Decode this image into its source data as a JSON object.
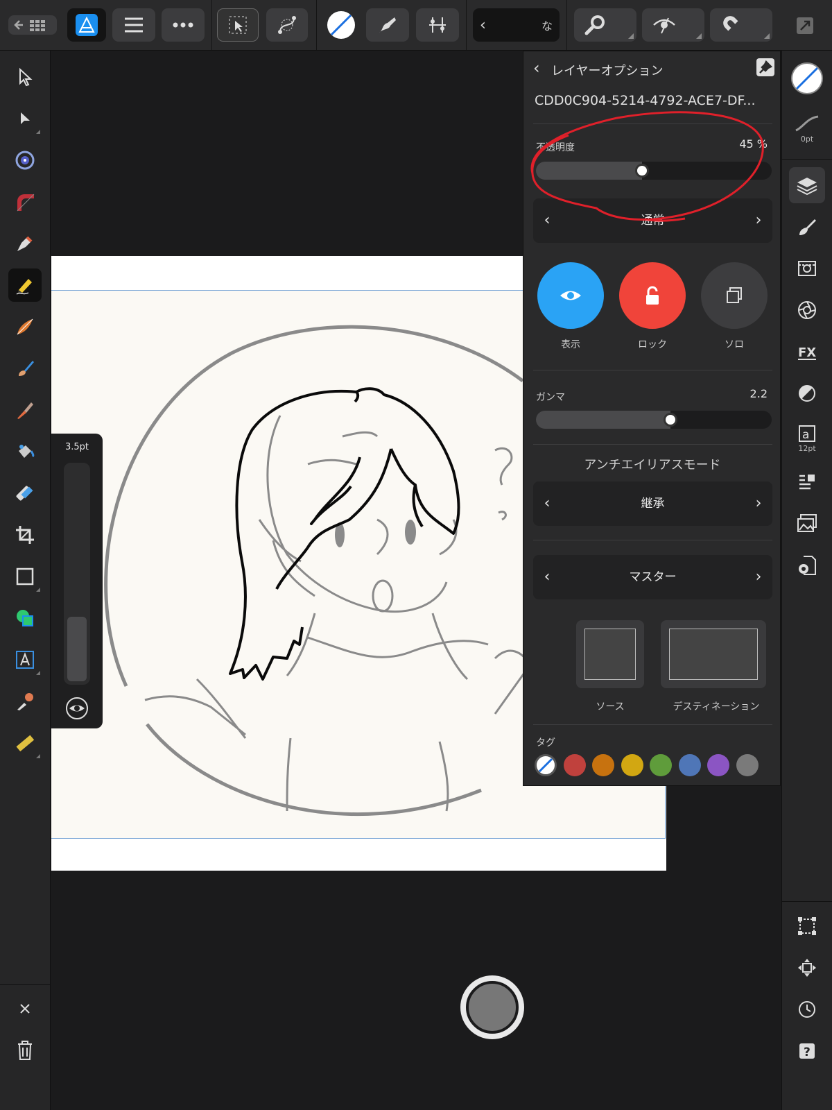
{
  "toolbar": {
    "right_tab_label_partial": "な",
    "buttons": [
      "back-to-gallery",
      "affinity-designer-persona",
      "document-menu",
      "more-menu",
      "selection-tool",
      "node-tool",
      "color-swatch",
      "pencil-persona",
      "snapping",
      "back-chevron",
      "zoom",
      "view-mode",
      "magnet",
      "fullscreen"
    ]
  },
  "left_tools": [
    "move-tool",
    "node-tool",
    "point-transform",
    "corner-tool",
    "pen-tool",
    "pencil-tool",
    "vector-brush",
    "fill-tool",
    "transparency-tool",
    "crop-tool",
    "rectangle-tool",
    "shape-tool",
    "artistic-text-tool",
    "color-picker",
    "measure-tool"
  ],
  "brush_size": {
    "label": "3.5pt",
    "value_fraction": 0.3
  },
  "right_studio": {
    "stroke_width_label": "0pt",
    "text_size_label": "12pt"
  },
  "layer_panel": {
    "title": "レイヤーオプション",
    "layer_name": "CDD0C904-5214-4792-ACE7-DF...",
    "opacity_label": "不透明度",
    "opacity_value": "45 %",
    "opacity_fraction": 0.45,
    "blend_mode": "通常",
    "toggles": [
      {
        "label": "表示",
        "color": "#2aa3f5"
      },
      {
        "label": "ロック",
        "color": "#f0443a"
      },
      {
        "label": "ソロ",
        "color": "#3d3d3f"
      }
    ],
    "gamma_label": "ガンマ",
    "gamma_value": "2.2",
    "gamma_fraction": 0.57,
    "antialias_title": "アンチエイリアスモード",
    "antialias_value": "継承",
    "master_value": "マスター",
    "source_label": "ソース",
    "destination_label": "デスティネーション",
    "tags_label": "タグ",
    "tag_colors": [
      "none",
      "#c0413d",
      "#c7720f",
      "#d2a712",
      "#5f9c3b",
      "#4f76b7",
      "#8b55c3",
      "#7a7a7a"
    ]
  },
  "colors": {
    "accent": "#2aa3f5",
    "annotation_circle": "#e0202a",
    "stroke_black": "#0a0a0a",
    "sketch_gray": "#8a8a8a"
  }
}
